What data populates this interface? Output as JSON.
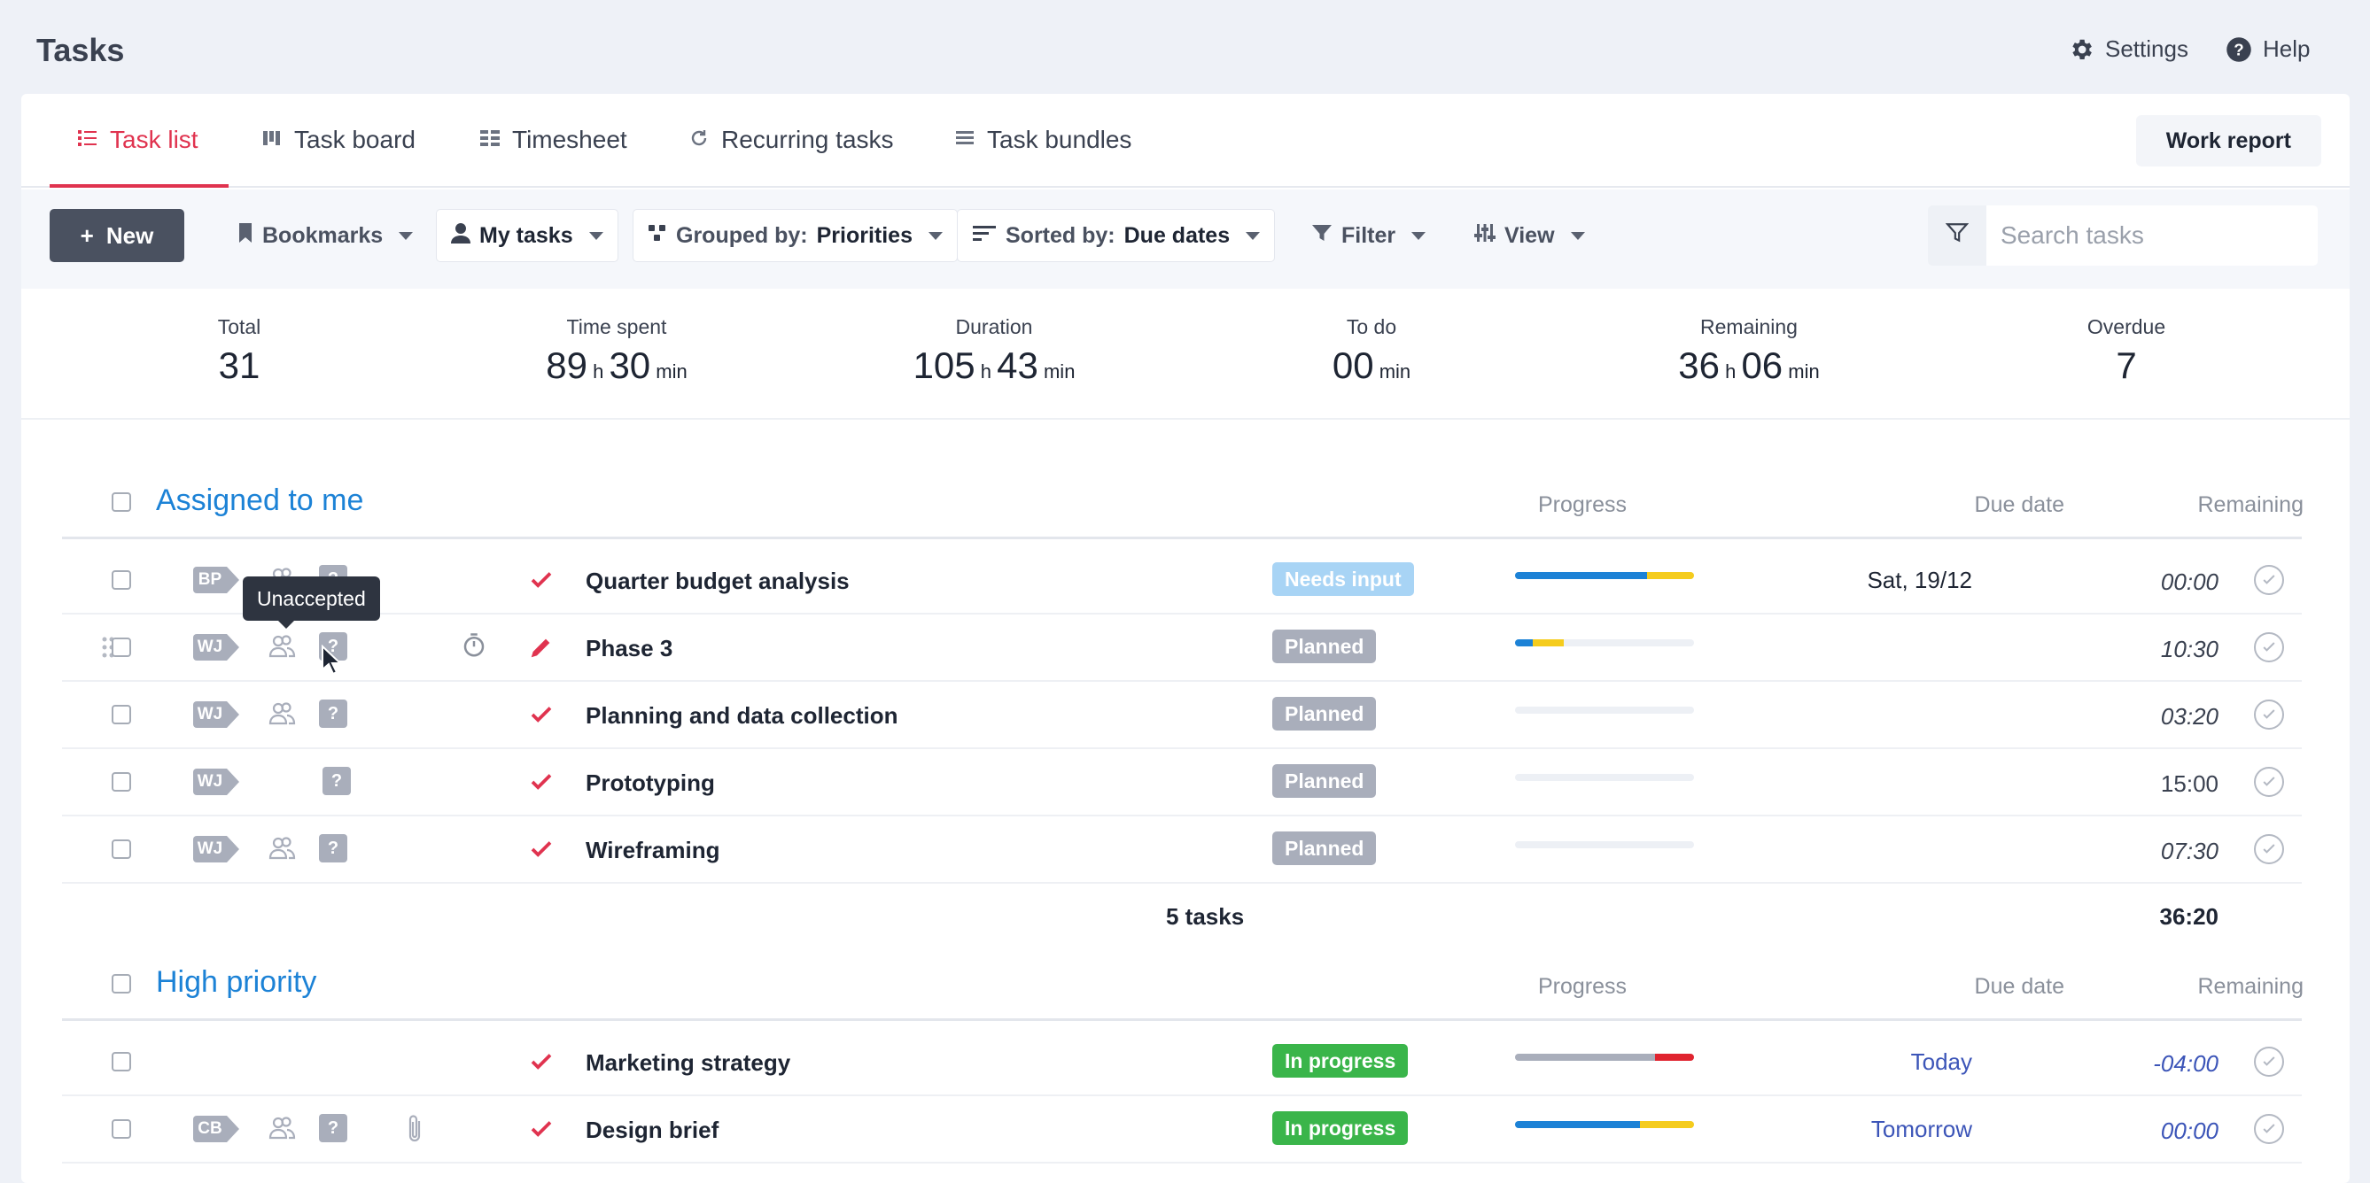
{
  "header": {
    "title": "Tasks",
    "settings_label": "Settings",
    "help_label": "Help"
  },
  "tabs": [
    {
      "label": "Task list",
      "icon": "list-icon",
      "active": true
    },
    {
      "label": "Task board",
      "icon": "board-icon",
      "active": false
    },
    {
      "label": "Timesheet",
      "icon": "timesheet-icon",
      "active": false
    },
    {
      "label": "Recurring tasks",
      "icon": "refresh-icon",
      "active": false
    },
    {
      "label": "Task bundles",
      "icon": "bundle-icon",
      "active": false
    }
  ],
  "work_report_label": "Work report",
  "toolbar": {
    "new_label": "New",
    "bookmarks_label": "Bookmarks",
    "my_tasks_label": "My tasks",
    "grouped_prefix": "Grouped by:",
    "grouped_value": "Priorities",
    "sorted_prefix": "Sorted by:",
    "sorted_value": "Due dates",
    "filter_label": "Filter",
    "view_label": "View",
    "search_placeholder": "Search tasks"
  },
  "stats": {
    "total": {
      "label": "Total",
      "value": "31"
    },
    "time_spent": {
      "label": "Time spent",
      "h": "89",
      "m": "30",
      "h_unit": "h",
      "m_unit": "min"
    },
    "duration": {
      "label": "Duration",
      "h": "105",
      "m": "43",
      "h_unit": "h",
      "m_unit": "min"
    },
    "to_do": {
      "label": "To do",
      "m": "00",
      "m_unit": "min"
    },
    "remaining": {
      "label": "Remaining",
      "h": "36",
      "m": "06",
      "h_unit": "h",
      "m_unit": "min"
    },
    "overdue": {
      "label": "Overdue",
      "value": "7"
    }
  },
  "columns": {
    "progress": "Progress",
    "due_date": "Due date",
    "remaining": "Remaining"
  },
  "groups": [
    {
      "title": "Assigned to me",
      "rows": [
        {
          "initials": "BP",
          "name": "Quarter budget analysis",
          "status": "Needs input",
          "status_color": "#a8d4f5",
          "progress": [
            {
              "color": "#1c82d6",
              "frac": 0.74
            },
            {
              "color": "#f5cc1d",
              "frac": 0.26
            }
          ],
          "due": "Sat, 19/12",
          "due_color": "#1e2533",
          "remaining": "00:00",
          "italic": true,
          "mark": "check",
          "people": true,
          "timer": false,
          "clip": false
        },
        {
          "initials": "WJ",
          "name": "Phase 3",
          "status": "Planned",
          "status_color": "#a9aebb",
          "progress": [
            {
              "color": "#1c82d6",
              "frac": 0.1
            },
            {
              "color": "#f5cc1d",
              "frac": 0.17
            }
          ],
          "due": "",
          "due_color": "#1e2533",
          "remaining": "10:30",
          "italic": true,
          "mark": "pencil",
          "people": true,
          "timer": true,
          "clip": false
        },
        {
          "initials": "WJ",
          "name": "Planning and data collection",
          "status": "Planned",
          "status_color": "#a9aebb",
          "progress": [],
          "due": "",
          "due_color": "#1e2533",
          "remaining": "03:20",
          "italic": true,
          "mark": "check",
          "people": true,
          "timer": false,
          "clip": false
        },
        {
          "initials": "WJ",
          "name": "Prototyping",
          "status": "Planned",
          "status_color": "#a9aebb",
          "progress": [],
          "due": "",
          "due_color": "#1e2533",
          "remaining": "15:00",
          "italic": false,
          "mark": "check",
          "people": false,
          "timer": false,
          "clip": false
        },
        {
          "initials": "WJ",
          "name": "Wireframing",
          "status": "Planned",
          "status_color": "#a9aebb",
          "progress": [],
          "due": "",
          "due_color": "#1e2533",
          "remaining": "07:30",
          "italic": true,
          "mark": "check",
          "people": true,
          "timer": false,
          "clip": false
        }
      ],
      "summary": {
        "count": "5 tasks",
        "total": "36:20"
      }
    },
    {
      "title": "High priority",
      "rows": [
        {
          "initials": "",
          "name": "Marketing strategy",
          "status": "In progress",
          "status_color": "#3ab54a",
          "progress": [
            {
              "color": "#a9aebb",
              "frac": 0.78
            },
            {
              "color": "#e0242f",
              "frac": 0.22
            }
          ],
          "due": "Today",
          "due_color": "#3c55b8",
          "remaining": "-04:00",
          "italic": true,
          "remaining_color": "#3c55b8",
          "mark": "check",
          "people": false,
          "timer": false,
          "clip": false
        },
        {
          "initials": "CB",
          "name": "Design brief",
          "status": "In progress",
          "status_color": "#3ab54a",
          "progress": [
            {
              "color": "#1c82d6",
              "frac": 0.7
            },
            {
              "color": "#f5cc1d",
              "frac": 0.3
            }
          ],
          "due": "Tomorrow",
          "due_color": "#3c55b8",
          "remaining": "00:00",
          "italic": true,
          "remaining_color": "#3c55b8",
          "mark": "check",
          "people": true,
          "timer": false,
          "clip": true
        }
      ]
    }
  ],
  "tooltip": "Unaccepted",
  "colors": {
    "accent": "#e0334f",
    "link": "#1c82d6"
  }
}
